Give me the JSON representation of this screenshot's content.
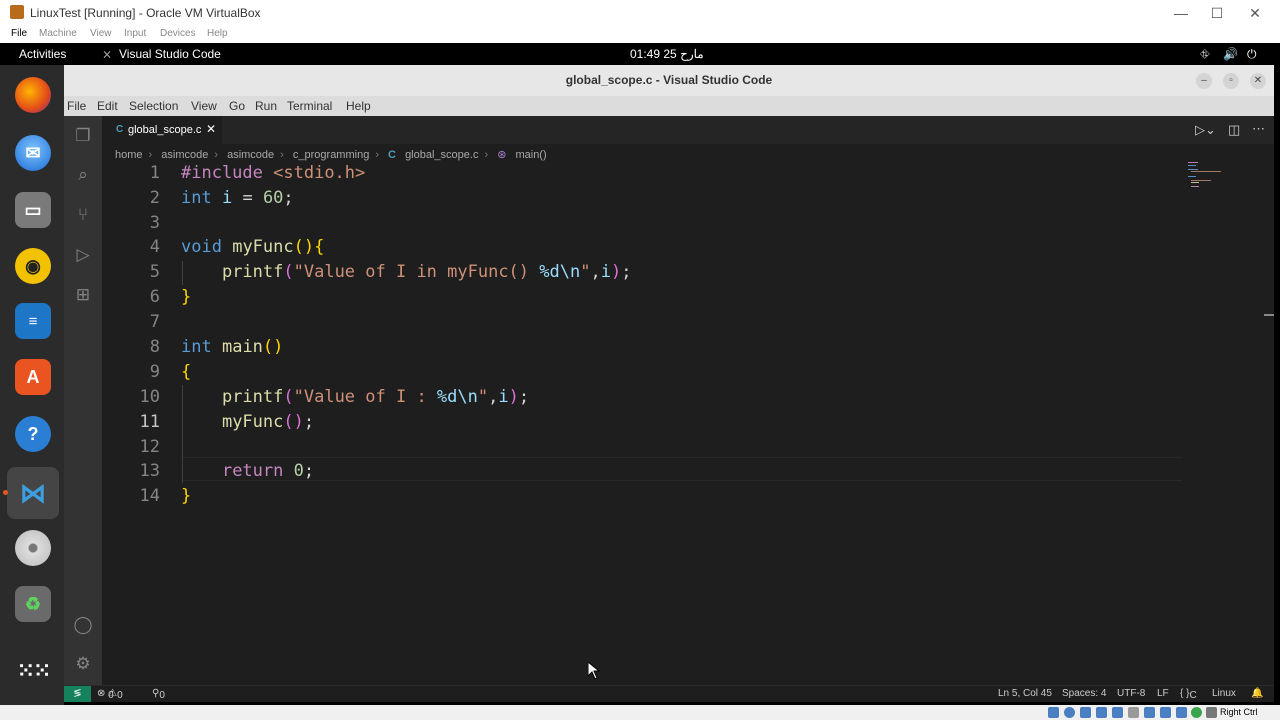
{
  "vbox": {
    "title": "LinuxTest [Running] - Oracle VM VirtualBox",
    "menu": [
      "File",
      "Machine",
      "View",
      "Input",
      "Devices",
      "Help"
    ],
    "host_key": "Right Ctrl",
    "controls": {
      "minimize": "—",
      "maximize": "☐",
      "close": "✕"
    }
  },
  "gnome": {
    "activities": "Activities",
    "app_name": "Visual Studio Code",
    "clock": "01:49  مارح 25"
  },
  "vscode": {
    "window_title": "global_scope.c - Visual Studio Code",
    "menu": [
      "File",
      "Edit",
      "Selection",
      "View",
      "Go",
      "Run",
      "Terminal",
      "Help"
    ],
    "tab": {
      "label": "global_scope.c",
      "icon": "C"
    },
    "breadcrumb": [
      "home",
      "asimcode",
      "asimcode",
      "c_programming",
      "global_scope.c",
      "main()"
    ],
    "current_line": 11,
    "code_lines": [
      "#include <stdio.h>",
      "int i = 60;",
      "",
      "void myFunc(){",
      "    printf(\"Value of I in myFunc() %d\\n\",i);",
      "}",
      "",
      "int main()",
      "{",
      "    printf(\"Value of I : %d\\n\",i);",
      "    myFunc();",
      "",
      "    return 0;",
      "}"
    ],
    "status": {
      "errors": "0",
      "warnings": "0",
      "ports": "0",
      "position": "Ln 5, Col 45",
      "spaces": "Spaces: 4",
      "encoding": "UTF-8",
      "eol": "LF",
      "language": "C",
      "platform": "Linux"
    }
  },
  "dock": {
    "apps": [
      "firefox-icon",
      "thunderbird-icon",
      "files-icon",
      "rhythmbox-icon",
      "libreoffice-writer-icon",
      "app-center-icon",
      "help-icon",
      "vscode-icon",
      "dvd-icon",
      "trash-icon",
      "show-apps-icon"
    ]
  },
  "colors": {
    "editor_bg": "#1e1e1e",
    "keyword": "#569cd6",
    "preprocessor": "#c586c0",
    "function": "#dcdcaa",
    "string": "#ce9178",
    "number": "#b5cea8",
    "remote_button": "#16825d"
  }
}
